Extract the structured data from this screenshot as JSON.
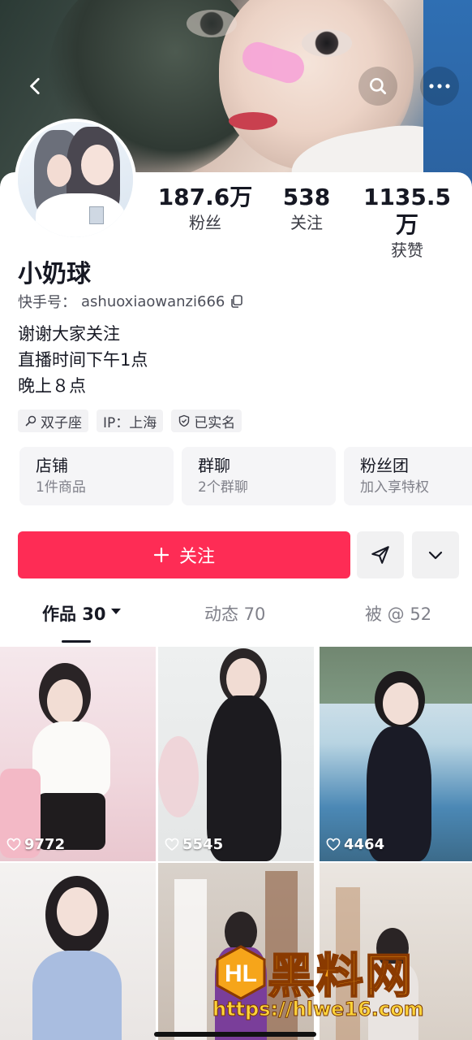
{
  "profile": {
    "name": "小奶球",
    "account_label": "快手号：",
    "account_id": "ashuoxiaowanzi666",
    "bio": [
      "谢谢大家关注",
      "直播时间下午1点",
      "晚上８点"
    ]
  },
  "stats": [
    {
      "value": "187.6万",
      "label": "粉丝"
    },
    {
      "value": "538",
      "label": "关注"
    },
    {
      "value": "1135.5万",
      "label": "获赞"
    }
  ],
  "tags": [
    {
      "icon": "search-icon",
      "label": "双子座"
    },
    {
      "icon": "",
      "label": "IP：上海"
    },
    {
      "icon": "shield-icon",
      "label": "已实名"
    }
  ],
  "cards": [
    {
      "title": "店铺",
      "subtitle": "1件商品"
    },
    {
      "title": "群聊",
      "subtitle": "2个群聊"
    },
    {
      "title": "粉丝团",
      "subtitle": "加入享特权"
    }
  ],
  "actions": {
    "follow_label": "关注"
  },
  "tabs": [
    {
      "label": "作品 30",
      "active": true
    },
    {
      "label": "动态 70",
      "active": false
    },
    {
      "label": "被 @ 52",
      "active": false
    }
  ],
  "videos": [
    {
      "likes": "9772"
    },
    {
      "likes": "5545"
    },
    {
      "likes": "4464"
    },
    {
      "likes": ""
    },
    {
      "likes": ""
    },
    {
      "likes": ""
    }
  ],
  "watermark": {
    "title": "黑料网",
    "url": "https://hlwe16.com"
  },
  "colors": {
    "accent": "#fe2c55",
    "text": "#161823",
    "muted": "#80818a",
    "chip_bg": "#f2f2f4"
  }
}
